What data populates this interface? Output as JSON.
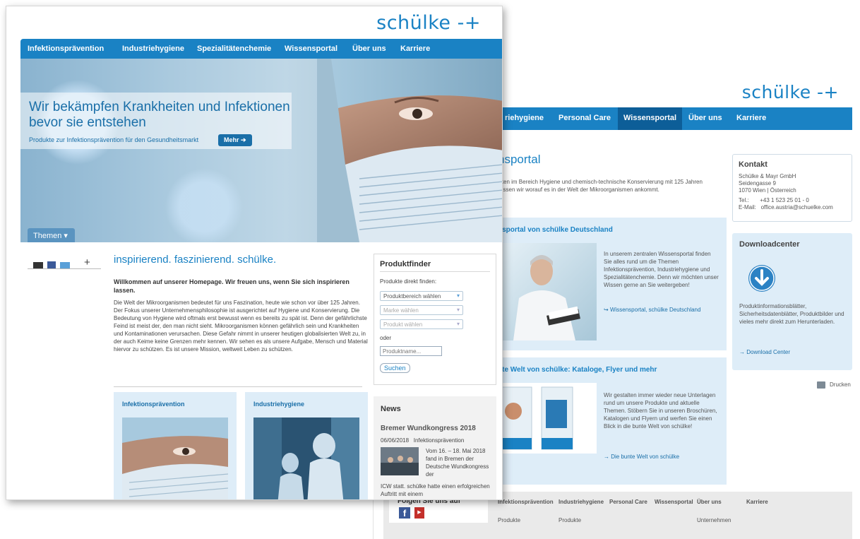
{
  "back": {
    "logo": "schülke -+",
    "nav": [
      "riehygiene",
      "Personal Care",
      "Wissensportal",
      "Über uns",
      "Karriere"
    ],
    "section_title": "nsportal",
    "section_text": "isten im Bereich Hygiene und chemisch-technische Konservierung mit 125 Jahren wissen wir worauf es in der Welt der Mikroorganismen ankommt.",
    "panel1": {
      "heading": "nsportal von schülke Deutschland",
      "text": "In unserem zentralen Wissensportal finden Sie alles rund um die Themen Infektionsprävention, Industriehygiene und Spezialitätenchemie. Denn wir möchten unser Wissen gerne an Sie weitergeben!",
      "link": "Wissensportal, schülke Deutschland"
    },
    "panel2": {
      "heading": "nte Welt von schülke: Kataloge, Flyer und mehr",
      "text": "Wir gestalten immer wieder neue Unterlagen rund um unsere Produkte und aktuelle Themen. Stöbern Sie in unseren Broschüren, Katalogen und Flyern und werfen Sie einen Blick in die bunte Welt von schülke!",
      "link": "Die bunte Welt von schülke"
    },
    "contact": {
      "title": "Kontakt",
      "company": "Schülke & Mayr GmbH",
      "street": "Seidengasse 9",
      "city": "1070 Wien | Österreich",
      "tel_label": "Tel.:",
      "tel": "+43 1 523 25 01 - 0",
      "mail_label": "E-Mail:",
      "mail": "office.austria@schuelke.com"
    },
    "download": {
      "title": "Downloadcenter",
      "text": "Produktinformationsblätter, Sicherheitsdatenblätter, Produktbilder und vieles mehr direkt zum Herunterladen.",
      "link": "Download Center"
    },
    "print": "Drucken",
    "footer": {
      "follow": "Folgen Sie uns auf",
      "cols": [
        "Infektionsprävention",
        "Industriehygiene",
        "Personal Care",
        "Wissensportal",
        "Über uns",
        "Karriere"
      ],
      "sub1": "Produkte",
      "sub2": "Produkte",
      "sub3": "Unternehmen"
    }
  },
  "front": {
    "logo": "schülke -+",
    "nav": [
      "Infektionsprävention",
      "Industriehygiene",
      "Spezialitätenchemie",
      "Wissensportal",
      "Über uns",
      "Karriere"
    ],
    "hero": {
      "title": "Wir bekämpfen Krankheiten und Infektionen bevor sie entstehen",
      "sub": "Produkte zur Infektionsprävention für den Gesundheitsmarkt",
      "button": "Mehr ➔",
      "themen": "Themen ▾"
    },
    "headline": "inspirierend. faszinierend. schülke.",
    "welcome": "Willkommen auf unserer Homepage. Wir freuen uns, wenn Sie sich inspirieren lassen.",
    "body": "Die Welt der Mikroorganismen bedeutet für uns Faszination, heute wie schon vor über 125 Jahren. Der Fokus unserer Unternehmensphilosophie ist ausgerichtet auf Hygiene und Konservierung. Die Bedeutung von Hygiene wird oftmals erst bewusst wenn es bereits zu spät ist. Denn der gefährlichste Feind ist meist der, den man nicht sieht. Mikroorganismen können gefährlich sein und Krankheiten und Kontaminationen verursachen. Diese Gefahr nimmt in unserer heutigen globalisierten Welt zu, in der auch Keime keine Grenzen mehr kennen. Wir sehen es als unsere Aufgabe, Mensch und Material hiervor zu schützen. Es ist unsere Mission, weltweit Leben zu schützen.",
    "share_plus": "+",
    "produktfinder": {
      "title": "Produktfinder",
      "label": "Produkte direkt finden:",
      "select1": "Produktbereich wählen",
      "select2": "Marke wählen",
      "select3": "Produkt wählen",
      "oder": "oder",
      "placeholder": "Produktname...",
      "button": "Suchen"
    },
    "news": {
      "title": "News",
      "headline": "Bremer Wundkongress 2018",
      "date": "06/06/2018",
      "category": "Infektionsprävention",
      "text_right": "Vom 16. – 18. Mai 2018 fand in Bremen der Deutsche Wundkongress der",
      "text_below": "ICW statt. schülke hatte einen erfolgreichen Auftritt mit einem"
    },
    "cards": [
      "Infektionsprävention",
      "Industriehygiene"
    ]
  }
}
